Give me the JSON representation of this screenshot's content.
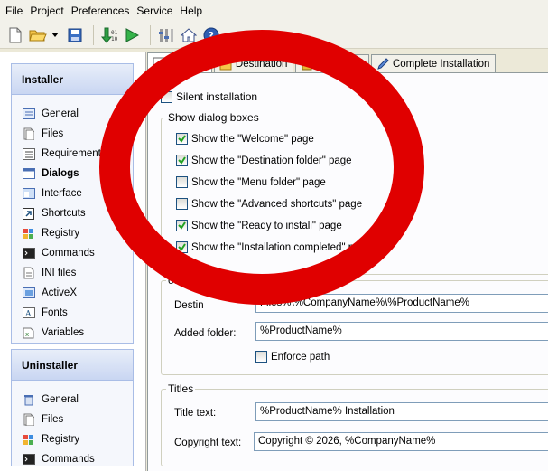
{
  "menu": [
    "File",
    "Project",
    "Preferences",
    "Service",
    "Help"
  ],
  "toolbar": {
    "icons": [
      "new-file-icon",
      "open-folder-icon",
      "dropdown-arrow-icon",
      "save-icon",
      "build-icon",
      "run-icon",
      "settings-icon",
      "home-icon",
      "help-icon"
    ]
  },
  "installer": {
    "title": "Installer",
    "items": [
      {
        "label": "General",
        "icon": "general-icon"
      },
      {
        "label": "Files",
        "icon": "files-icon"
      },
      {
        "label": "Requirements",
        "icon": "requirements-icon"
      },
      {
        "label": "Dialogs",
        "icon": "dialogs-icon"
      },
      {
        "label": "Interface",
        "icon": "interface-icon"
      },
      {
        "label": "Shortcuts",
        "icon": "shortcuts-icon"
      },
      {
        "label": "Registry",
        "icon": "registry-icon"
      },
      {
        "label": "Commands",
        "icon": "commands-icon"
      },
      {
        "label": "INI files",
        "icon": "ini-files-icon"
      },
      {
        "label": "ActiveX",
        "icon": "activex-icon"
      },
      {
        "label": "Fonts",
        "icon": "fonts-icon"
      },
      {
        "label": "Variables",
        "icon": "variables-icon"
      }
    ],
    "active": "Dialogs"
  },
  "uninstaller": {
    "title": "Uninstaller",
    "items": [
      {
        "label": "General",
        "icon": "trash-icon"
      },
      {
        "label": "Files",
        "icon": "files-icon"
      },
      {
        "label": "Registry",
        "icon": "registry-icon"
      },
      {
        "label": "Commands",
        "icon": "commands-icon"
      }
    ]
  },
  "tabs": [
    {
      "label": "General",
      "icon": "general-tab-icon"
    },
    {
      "label": "Destination",
      "icon": "destination-tab-icon"
    },
    {
      "label": "Password",
      "icon": "lock-icon"
    },
    {
      "label": "Complete Installation",
      "icon": "complete-icon"
    }
  ],
  "silent_installation": {
    "label": "Silent installation",
    "checked": false
  },
  "dialog_boxes": {
    "title": "Show dialog boxes",
    "items": [
      {
        "label": "Show the \"Welcome\" page",
        "checked": true
      },
      {
        "label": "Show the \"Destination folder\" page",
        "checked": true
      },
      {
        "label": "Show the \"Menu folder\" page",
        "checked": false
      },
      {
        "label": "Show the \"Advanced shortcuts\" page",
        "checked": false
      },
      {
        "label": "Show the \"Ready to install\" page",
        "checked": true
      },
      {
        "label": "Show the \"Installation completed\" page",
        "checked": true
      }
    ]
  },
  "product_folder": {
    "title": "oduct folder",
    "destination_label": "Destin",
    "destination_value": "Files%\\%CompanyName%\\%ProductName%",
    "added_folder_label": "Added folder:",
    "added_folder_value": "%ProductName%",
    "enforce_path_label": "Enforce path",
    "enforce_path_checked": false
  },
  "titles": {
    "title": "Titles",
    "title_text_label": "Title text:",
    "title_text_value": "%ProductName% Installation",
    "copyright_label": "Copyright text:",
    "copyright_value": "Copyright © 2026, %CompanyName%"
  },
  "colors": {
    "annotation_red": "#e00000",
    "panel_border": "#a9bde6",
    "checkbox_border": "#1c5180"
  }
}
